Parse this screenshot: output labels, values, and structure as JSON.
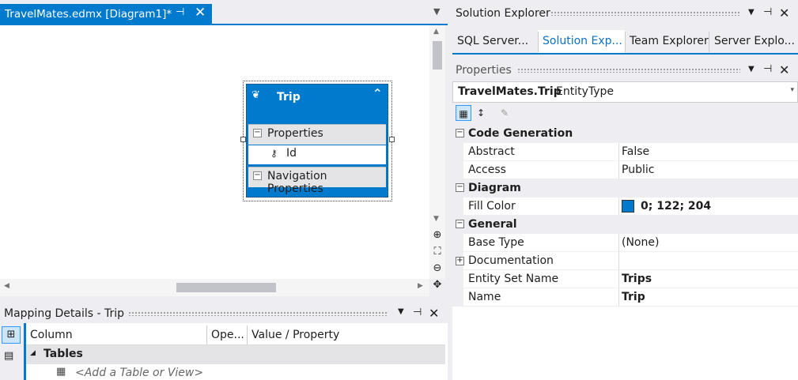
{
  "designer": {
    "tab_title": "TravelMates.edmx [Diagram1]*",
    "pin_glyph": "⊣",
    "close_glyph": "✕",
    "dropdown_glyph": "▼",
    "entity": {
      "name": "Trip",
      "properties_label": "Properties",
      "property_id": "Id",
      "navigation_label": "Navigation Properties",
      "color": "#007acc"
    }
  },
  "mapping": {
    "title": "Mapping Details - Trip",
    "columns": [
      "Column",
      "Ope...",
      "Value / Property"
    ],
    "tables_label": "Tables",
    "add_label": "<Add a Table or View>"
  },
  "solution_explorer": {
    "title": "Solution Explorer",
    "tabs": [
      "SQL Server...",
      "Solution Exp...",
      "Team Explorer",
      "Server Explo..."
    ],
    "active_tab": "Solution Exp..."
  },
  "properties": {
    "title": "Properties",
    "object_name": "TravelMates.Trip",
    "object_type": "EntityType",
    "categories": {
      "code_generation": "Code Generation",
      "diagram": "Diagram",
      "general": "General"
    },
    "rows": {
      "abstract": {
        "name": "Abstract",
        "value": "False"
      },
      "access": {
        "name": "Access",
        "value": "Public"
      },
      "fill_color": {
        "name": "Fill Color",
        "value": "0; 122; 204"
      },
      "base_type": {
        "name": "Base Type",
        "value": "(None)"
      },
      "documentation": {
        "name": "Documentation",
        "value": ""
      },
      "entity_set_name": {
        "name": "Entity Set Name",
        "value": "Trips"
      },
      "name": {
        "name": "Name",
        "value": "Trip"
      }
    }
  },
  "colors": {
    "accent": "#007acc",
    "chrome": "#eeeef2"
  }
}
